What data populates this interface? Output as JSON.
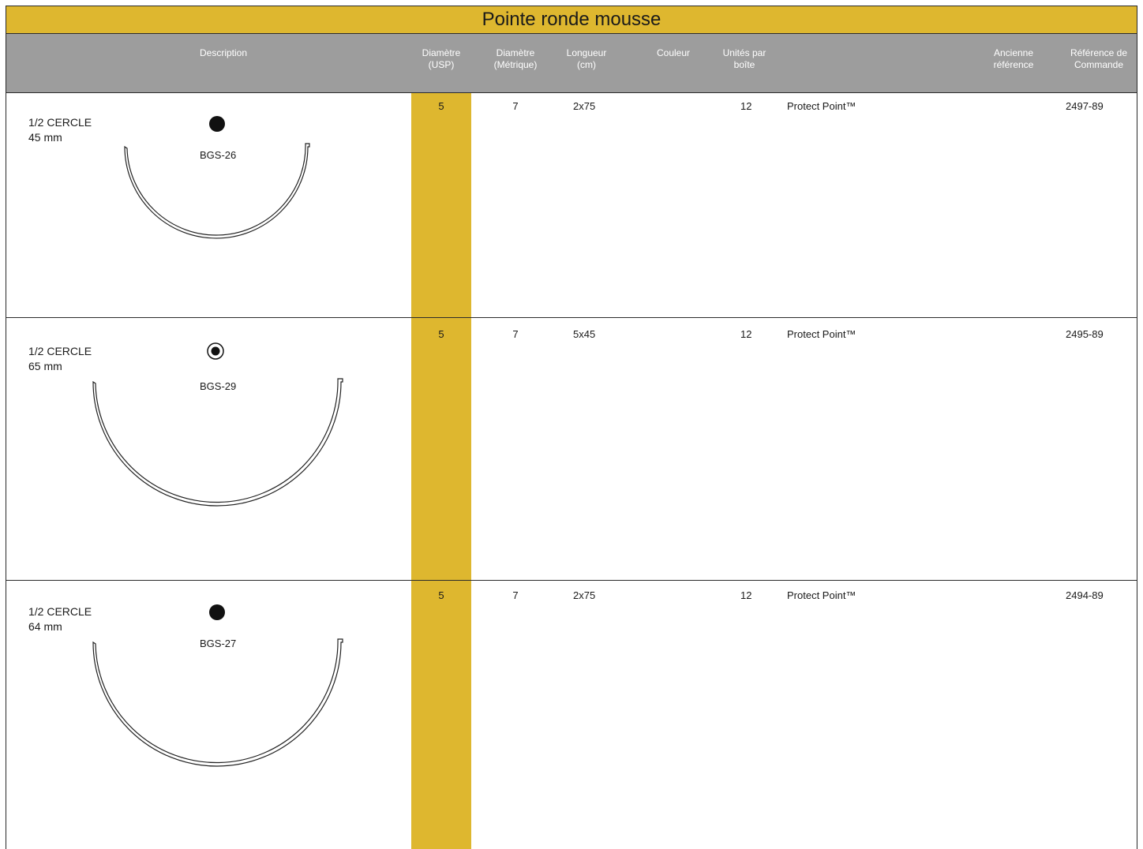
{
  "title": "Pointe ronde mousse",
  "headers": {
    "description": "Description",
    "diametre_usp": "Diamètre\n(USP)",
    "diametre_metrique": "Diamètre\n(Métrique)",
    "longueur": "Longueur\n(cm)",
    "couleur": "Couleur",
    "unites": "Unités par\nboîte",
    "ancienne_ref": "Ancienne\nréférence",
    "ref_commande": "Référence de\nCommande"
  },
  "colors": {
    "accent": "#deb72f",
    "header": "#9d9d9d",
    "border": "#2b2b2b"
  },
  "rows": [
    {
      "shape_line1": "1/2 CERCLE",
      "shape_line2": "45 mm",
      "needle_code": "BGS-26",
      "point_icon": "filled-circle-icon",
      "usp": "5",
      "metrique": "7",
      "longueur": "2x75",
      "couleur": "",
      "unites": "12",
      "note": "Protect Point™",
      "ancienne": "",
      "reference": "2497-89"
    },
    {
      "shape_line1": "1/2 CERCLE",
      "shape_line2": "65 mm",
      "needle_code": "BGS-29",
      "point_icon": "ringed-circle-icon",
      "usp": "5",
      "metrique": "7",
      "longueur": "5x45",
      "couleur": "",
      "unites": "12",
      "note": "Protect Point™",
      "ancienne": "",
      "reference": "2495-89"
    },
    {
      "shape_line1": "1/2 CERCLE",
      "shape_line2": "64 mm",
      "needle_code": "BGS-27",
      "point_icon": "filled-circle-icon",
      "usp": "5",
      "metrique": "7",
      "longueur": "2x75",
      "couleur": "",
      "unites": "12",
      "note": "Protect Point™",
      "ancienne": "",
      "reference": "2494-89"
    }
  ]
}
